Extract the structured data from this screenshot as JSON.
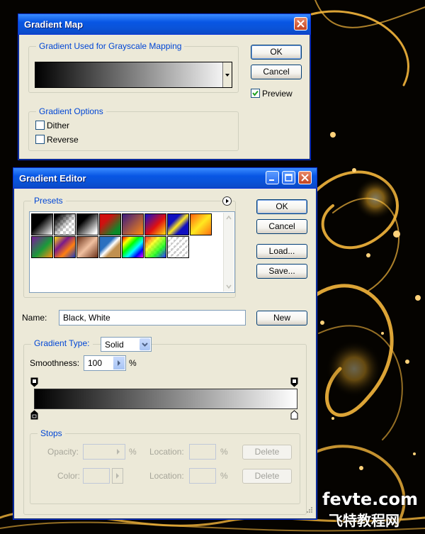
{
  "gradient_map": {
    "title": "Gradient Map",
    "group_used_label": "Gradient Used for Grayscale Mapping",
    "ok_label": "OK",
    "cancel_label": "Cancel",
    "preview_label": "Preview",
    "preview_checked": true,
    "options_label": "Gradient Options",
    "dither_label": "Dither",
    "reverse_label": "Reverse"
  },
  "gradient_editor": {
    "title": "Gradient Editor",
    "presets_label": "Presets",
    "ok_label": "OK",
    "cancel_label": "Cancel",
    "load_label": "Load...",
    "save_label": "Save...",
    "name_label": "Name:",
    "name_value": "Black, White",
    "new_label": "New",
    "gradient_type_label": "Gradient Type:",
    "gradient_type_value": "Solid",
    "smoothness_label": "Smoothness:",
    "smoothness_value": "100",
    "percent": "%",
    "stops_label": "Stops",
    "opacity_label": "Opacity:",
    "location_label": "Location:",
    "color_label": "Color:",
    "delete_label": "Delete"
  },
  "watermark": {
    "site": "fevte.com",
    "cn": "飞特教程网"
  },
  "icons": {
    "close": "close-icon",
    "minimize": "minimize-icon",
    "maximize": "maximize-icon",
    "menu": "menu-arrow-icon"
  },
  "colors": {
    "accent": "#0046d5",
    "titlebar": "#0a53d8",
    "dialog_bg": "#ece9d8"
  }
}
